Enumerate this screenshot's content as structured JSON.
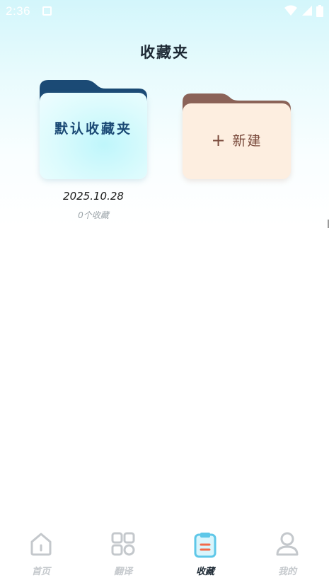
{
  "status_bar": {
    "time": "2:36"
  },
  "page": {
    "title": "收藏夹"
  },
  "folders": [
    {
      "name": "默认收藏夹",
      "date": "2025.10.28",
      "count_text": "0个收藏"
    }
  ],
  "new_folder": {
    "label": "新建",
    "icon": "plus-icon"
  },
  "bottom_nav": {
    "active_index": 2,
    "items": [
      {
        "label": "首页",
        "icon": "home-icon"
      },
      {
        "label": "翻译",
        "icon": "grid-icon"
      },
      {
        "label": "收藏",
        "icon": "clipboard-icon"
      },
      {
        "label": "我的",
        "icon": "person-icon"
      }
    ]
  },
  "colors": {
    "title_text": "#1e2a35",
    "default_folder_tab": "#1b4a75",
    "default_folder_label": "#1b4a75",
    "new_folder_tab": "#8b6358",
    "new_folder_body": "#fdeee0",
    "new_folder_label": "#7a4a3c",
    "nav_inactive": "#c4c8cc",
    "nav_active_icon": "#5ec7e8",
    "nav_active_accent": "#f26a4a"
  }
}
